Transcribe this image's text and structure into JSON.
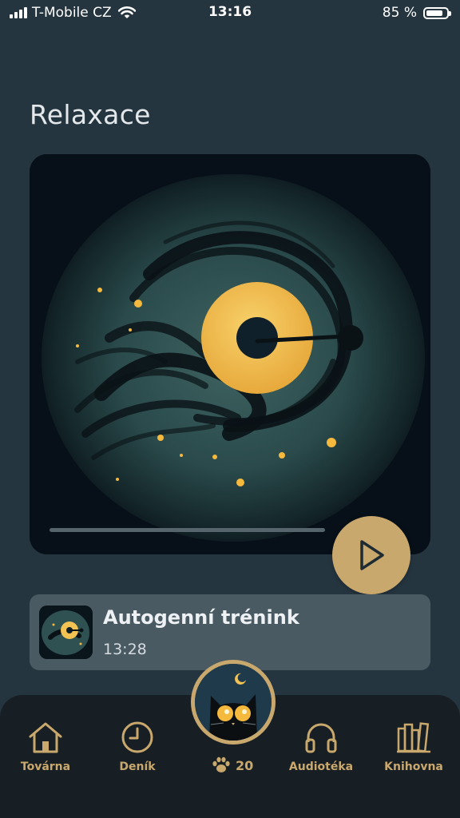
{
  "status_bar": {
    "carrier": "T-Mobile CZ",
    "time": "13:16",
    "battery": "85 %",
    "battery_level": 0.85
  },
  "page": {
    "title": "Relaxace"
  },
  "player": {
    "progress": 0.0,
    "play_icon": "play-icon"
  },
  "track": {
    "title": "Autogenní trénink",
    "duration": "13:28"
  },
  "nav": {
    "items": [
      {
        "label": "Továrna",
        "icon": "home-icon"
      },
      {
        "label": "Deník",
        "icon": "clock-icon"
      },
      {
        "label": "Audiotéka",
        "icon": "headphones-icon"
      },
      {
        "label": "Knihovna",
        "icon": "books-icon"
      }
    ],
    "paw_count": "20"
  },
  "colors": {
    "background": "#253540",
    "accent": "#c9a86d",
    "card": "#4a5a63",
    "nav": "#181f24"
  }
}
